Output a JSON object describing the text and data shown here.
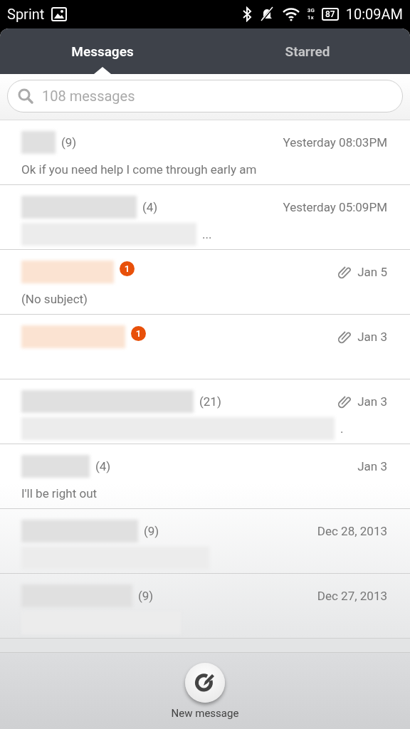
{
  "status_bar": {
    "carrier": "Sprint",
    "network_top": "3G",
    "network_bottom": "1x",
    "battery": "87",
    "time": "10:09AM"
  },
  "tabs": [
    {
      "label": "Messages",
      "selected": true
    },
    {
      "label": "Starred",
      "selected": false
    }
  ],
  "search": {
    "placeholder": "108 messages"
  },
  "threads": [
    {
      "count": "(9)",
      "time": "Yesterday 08:03PM",
      "attachment": false,
      "unread": false,
      "preview": "Ok if you need help I come through early am"
    },
    {
      "count": "(4)",
      "time": "Yesterday 05:09PM",
      "attachment": false,
      "unread": false,
      "preview_redacted": true,
      "preview_tail": "..."
    },
    {
      "time": "Jan 5",
      "attachment": true,
      "unread": true,
      "badge": "1",
      "preview": "(No subject)"
    },
    {
      "time": "Jan 3",
      "attachment": true,
      "unread": true,
      "badge": "1"
    },
    {
      "count": "(21)",
      "time": "Jan 3",
      "attachment": true,
      "unread": false,
      "preview_redacted": true,
      "preview_tail": "."
    },
    {
      "count": "(4)",
      "time": "Jan 3",
      "attachment": false,
      "unread": false,
      "preview": "I'll be right out"
    },
    {
      "count": "(9)",
      "time": "Dec 28, 2013",
      "attachment": false,
      "unread": false,
      "preview_redacted": true
    },
    {
      "count": "(9)",
      "time": "Dec 27, 2013",
      "attachment": false,
      "unread": false,
      "preview_redacted": true
    }
  ],
  "new_message": {
    "label": "New message"
  }
}
